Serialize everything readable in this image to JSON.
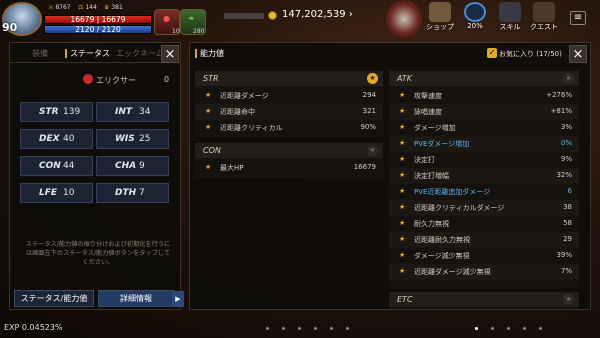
{
  "hud": {
    "level": "90",
    "small_left": "8767",
    "small_mid": "144",
    "small_right": "381",
    "hp_text": "16679 | 16679",
    "mp_text": "2120 / 2120",
    "hp_fraction": 1.0,
    "mp_fraction": 1.0,
    "item1_count": "100",
    "item2_count": "280",
    "gold": "147,202,539",
    "menu": [
      {
        "label": "ショップ",
        "icon": "shop-icon"
      },
      {
        "label": "20%",
        "icon": "progress-ring-icon"
      },
      {
        "label": "スキル",
        "icon": "skill-icon"
      },
      {
        "label": "クエスト",
        "icon": "quest-icon"
      }
    ]
  },
  "left_panel": {
    "tabs": [
      "装備",
      "ステータス",
      "エックネーム"
    ],
    "elixir_label": "エリクサー",
    "elixir_value": "0",
    "stats": [
      {
        "key": "STR",
        "value": "139"
      },
      {
        "key": "INT",
        "value": "34"
      },
      {
        "key": "DEX",
        "value": "40"
      },
      {
        "key": "WIS",
        "value": "25"
      },
      {
        "key": "CON",
        "value": "44"
      },
      {
        "key": "CHA",
        "value": "9"
      },
      {
        "key": "LFE",
        "value": "10"
      },
      {
        "key": "DTH",
        "value": "7"
      }
    ],
    "note": "ステータス/能力値の振り分けおよび初期化を行うには画面左下のステータス/能力値ボタンをタップしてください。",
    "btn_stat": "ステータス/能力値",
    "btn_detail": "詳細情報"
  },
  "right_panel": {
    "title": "能力値",
    "fav_label": "お気に入り (17/50)",
    "str": {
      "title": "STR",
      "rows": [
        {
          "name": "近距離ダメージ",
          "value": "294"
        },
        {
          "name": "近距離命中",
          "value": "321"
        },
        {
          "name": "近距離クリティカル",
          "value": "90%"
        }
      ]
    },
    "con": {
      "title": "CON",
      "rows": [
        {
          "name": "最大HP",
          "value": "16679"
        }
      ]
    },
    "atk": {
      "title": "ATK",
      "rows": [
        {
          "name": "攻撃速度",
          "value": "+276%"
        },
        {
          "name": "詠唱速度",
          "value": "+81%"
        },
        {
          "name": "ダメージ増加",
          "value": "3%"
        },
        {
          "name": "PVEダメージ増加",
          "value": "0%",
          "blue": true
        },
        {
          "name": "決定打",
          "value": "9%"
        },
        {
          "name": "決定打増幅",
          "value": "32%"
        },
        {
          "name": "PVE近距離追加ダメージ",
          "value": "6",
          "blue": true
        },
        {
          "name": "近距離クリティカルダメージ",
          "value": "38"
        },
        {
          "name": "耐久力無視",
          "value": "58"
        },
        {
          "name": "近距離耐久力無視",
          "value": "29"
        },
        {
          "name": "ダメージ減少無視",
          "value": "39%"
        },
        {
          "name": "近距離ダメージ減少無視",
          "value": "7%"
        }
      ]
    },
    "etc": {
      "title": "ETC"
    }
  },
  "footer": {
    "exp": "EXP 0.04523%"
  },
  "colors": {
    "accent_gold": "#e0a82e",
    "stat_blue": "#5cb6e8",
    "hp_red": "#e02a22",
    "mp_blue": "#3f74d6"
  }
}
